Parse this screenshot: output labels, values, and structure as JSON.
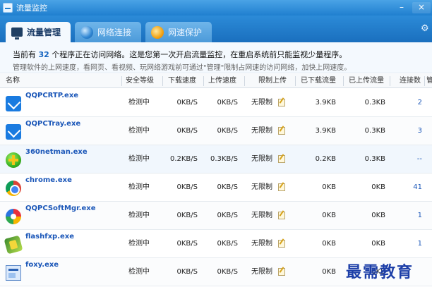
{
  "window": {
    "title": "流量监控",
    "minimize": "–",
    "close": "×"
  },
  "tabs": [
    {
      "label": "流量管理",
      "icon": "monitor-icon",
      "active": true
    },
    {
      "label": "网络连接",
      "icon": "globe-icon",
      "active": false
    },
    {
      "label": "网速保护",
      "icon": "shield-icon",
      "active": false
    }
  ],
  "info": {
    "line1_prefix": "当前有",
    "process_count": "32",
    "line1_suffix": "个程序正在访问网络。这是您第一次开启流量监控，在重启系统前只能监视少量程序。",
    "line2": "管理软件的上网速度，看网页、看视频、玩网络游戏前可通过\"管理\"限制占网速的访问网络，加快上网速度。"
  },
  "columns": {
    "name": "名称",
    "security": "安全等级",
    "down_speed": "下载速度",
    "up_speed": "上传速度",
    "limit_upload": "限制上传",
    "downloaded": "已下载流量",
    "uploaded": "已上传流量",
    "connections": "连接数",
    "manage": "管"
  },
  "rows": [
    {
      "name": "QQPCRTP.exe",
      "icon": "qq-pc-manager-icon",
      "security": "检测中",
      "down": "0KB/S",
      "up": "0KB/S",
      "limit": "无限制",
      "downloaded": "3.9KB",
      "uploaded": "0.3KB",
      "connections": "2"
    },
    {
      "name": "QQPCTray.exe",
      "icon": "qq-pc-manager-icon",
      "security": "检测中",
      "down": "0KB/S",
      "up": "0KB/S",
      "limit": "无限制",
      "downloaded": "3.9KB",
      "uploaded": "0.3KB",
      "connections": "3"
    },
    {
      "name": "360netman.exe",
      "icon": "360-icon",
      "security": "检测中",
      "down": "0.2KB/S",
      "up": "0.3KB/S",
      "limit": "无限制",
      "downloaded": "0.2KB",
      "uploaded": "0.3KB",
      "connections": "--"
    },
    {
      "name": "chrome.exe",
      "icon": "chrome-icon",
      "security": "检测中",
      "down": "0KB/S",
      "up": "0KB/S",
      "limit": "无限制",
      "downloaded": "0KB",
      "uploaded": "0KB",
      "connections": "41"
    },
    {
      "name": "QQPCSoftMgr.exe",
      "icon": "qq-soft-manager-icon",
      "security": "检测中",
      "down": "0KB/S",
      "up": "0KB/S",
      "limit": "无限制",
      "downloaded": "0KB",
      "uploaded": "0KB",
      "connections": "1"
    },
    {
      "name": "flashfxp.exe",
      "icon": "flashfxp-icon",
      "security": "检测中",
      "down": "0KB/S",
      "up": "0KB/S",
      "limit": "无限制",
      "downloaded": "0KB",
      "uploaded": "0KB",
      "connections": "1"
    },
    {
      "name": "foxy.exe",
      "icon": "foxy-icon",
      "security": "检测中",
      "down": "0KB/S",
      "up": "0KB/S",
      "limit": "无限制",
      "downloaded": "0KB",
      "uploaded": "0KB",
      "connections": ""
    }
  ],
  "watermark": "最需教育"
}
